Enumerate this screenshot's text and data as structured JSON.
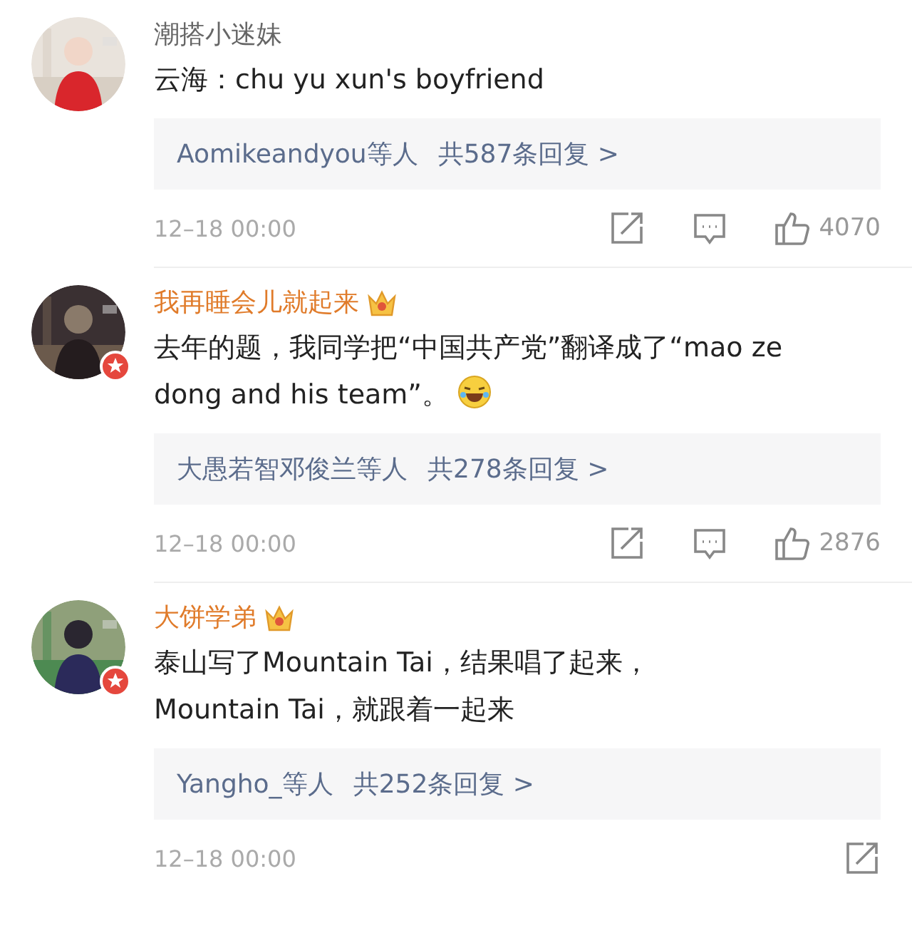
{
  "comments": [
    {
      "user": "潮搭小迷妹",
      "vip": false,
      "verified": false,
      "text": "云海：chu yu xun's boyfriend",
      "trailing_emoji": false,
      "reply_users": "Aomikeandyou等人",
      "reply_count": "共587条回复 >",
      "time": "12–18 00:00",
      "actions": [
        {
          "kind": "share"
        },
        {
          "kind": "comment"
        },
        {
          "kind": "like",
          "count": "4070"
        }
      ]
    },
    {
      "user": "我再睡会儿就起来",
      "vip": true,
      "verified": true,
      "text": "去年的题，我同学把“中国共产党”翻译成了“mao ze dong and his team”。",
      "trailing_emoji": true,
      "reply_users": "大愚若智邓俊兰等人",
      "reply_count": "共278条回复 >",
      "time": "12–18 00:00",
      "actions": [
        {
          "kind": "share"
        },
        {
          "kind": "comment"
        },
        {
          "kind": "like",
          "count": "2876"
        }
      ]
    },
    {
      "user": "大饼学弟",
      "vip": true,
      "verified": true,
      "text": "泰山写了Mountain Tai，结果唱了起来，\nMountain Tai，就跟着一起来",
      "trailing_emoji": false,
      "reply_users": "Yangho_等人",
      "reply_count": "共252条回复 >",
      "time": "12–18 00:00",
      "actions": [
        {
          "kind": "share"
        }
      ]
    }
  ]
}
